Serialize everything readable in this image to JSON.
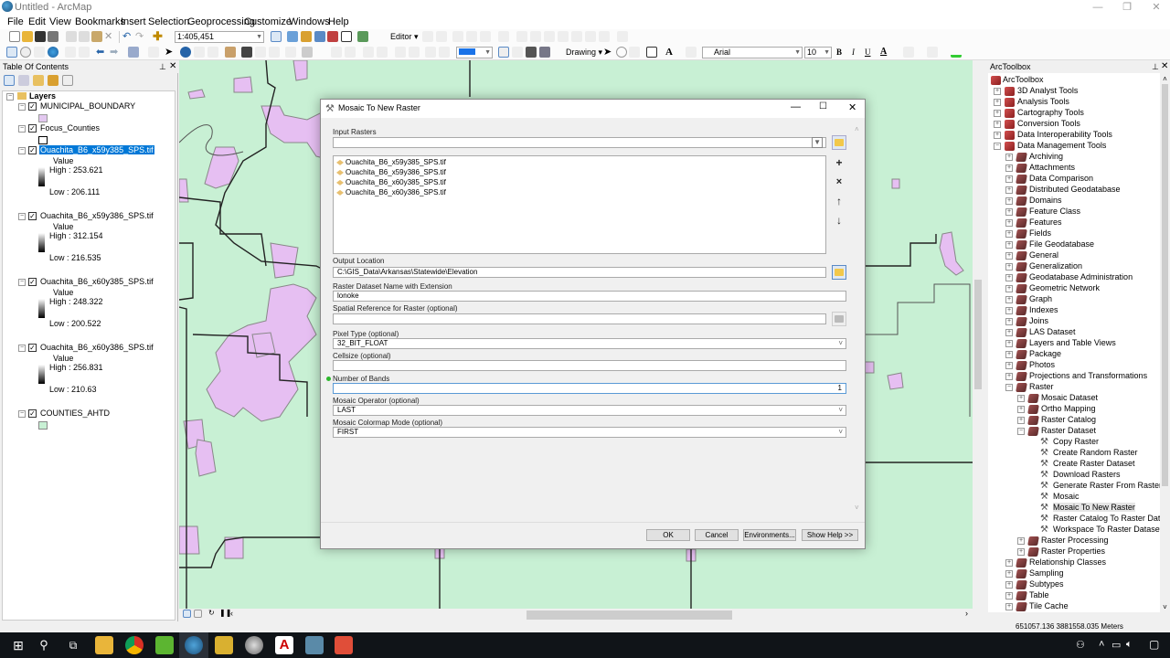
{
  "window": {
    "title": "Untitled - ArcMap",
    "controls": {
      "minimize": "—",
      "restore": "❐",
      "close": "✕"
    }
  },
  "menu": [
    "File",
    "Edit",
    "View",
    "Bookmarks",
    "Insert",
    "Selection",
    "Geoprocessing",
    "Customize",
    "Windows",
    "Help"
  ],
  "toolbar": {
    "scale_value": "1:405,451",
    "editor_label": "Editor ▾",
    "drawing_label": "Drawing ▾",
    "font_name": "Arial",
    "font_size": "10",
    "bold": "B",
    "italic": "I",
    "underline": "U",
    "font_color": "A"
  },
  "toc": {
    "title": "Table Of Contents",
    "root": "Layers",
    "layers": [
      {
        "name": "MUNICIPAL_BOUNDARY",
        "checked": true,
        "swatch": "#e3c8f0"
      },
      {
        "name": "Focus_Counties",
        "checked": true,
        "swatch": "#ffffff"
      },
      {
        "name": "Ouachita_B6_x59y385_SPS.tif",
        "checked": true,
        "selected": true,
        "legend_title": "Value",
        "high": "High : 253.621",
        "low": "Low : 206.111"
      },
      {
        "name": "Ouachita_B6_x59y386_SPS.tif",
        "checked": true,
        "legend_title": "Value",
        "high": "High : 312.154",
        "low": "Low : 216.535"
      },
      {
        "name": "Ouachita_B6_x60y385_SPS.tif",
        "checked": true,
        "legend_title": "Value",
        "high": "High : 248.322",
        "low": "Low : 200.522"
      },
      {
        "name": "Ouachita_B6_x60y386_SPS.tif",
        "checked": true,
        "legend_title": "Value",
        "high": "High : 256.831",
        "low": "Low : 210.63"
      },
      {
        "name": "COUNTIES_AHTD",
        "checked": true,
        "swatch": "#c8f0d4"
      }
    ]
  },
  "dialog": {
    "title": "Mosaic To New Raster",
    "input_rasters_label": "Input Rasters",
    "input_rasters_value": "",
    "input_rasters_list": [
      "Ouachita_B6_x59y385_SPS.tif",
      "Ouachita_B6_x59y386_SPS.tif",
      "Ouachita_B6_x60y385_SPS.tif",
      "Ouachita_B6_x60y386_SPS.tif"
    ],
    "output_location_label": "Output Location",
    "output_location_value": "C:\\GIS_Data\\Arkansas\\Statewide\\Elevation",
    "dataset_name_label": "Raster Dataset Name with Extension",
    "dataset_name_value": "lonoke",
    "spatial_ref_label": "Spatial Reference for Raster (optional)",
    "spatial_ref_value": "",
    "pixel_type_label": "Pixel Type (optional)",
    "pixel_type_value": "32_BIT_FLOAT",
    "cellsize_label": "Cellsize (optional)",
    "cellsize_value": "",
    "bands_label": "Number of Bands",
    "bands_value": "1",
    "mosaic_operator_label": "Mosaic Operator (optional)",
    "mosaic_operator_value": "LAST",
    "colormap_mode_label": "Mosaic Colormap Mode (optional)",
    "colormap_mode_value": "FIRST",
    "buttons": {
      "ok": "OK",
      "cancel": "Cancel",
      "environments": "Environments...",
      "show_help": "Show Help >>"
    },
    "side_buttons": {
      "add": "+",
      "remove": "×",
      "up": "↑",
      "down": "↓"
    }
  },
  "arctoolbox": {
    "title": "ArcToolbox",
    "root": "ArcToolbox",
    "items": [
      {
        "label": "3D Analyst Tools",
        "level": 0,
        "type": "toolbox",
        "expander": "+"
      },
      {
        "label": "Analysis Tools",
        "level": 0,
        "type": "toolbox",
        "expander": "+"
      },
      {
        "label": "Cartography Tools",
        "level": 0,
        "type": "toolbox",
        "expander": "+"
      },
      {
        "label": "Conversion Tools",
        "level": 0,
        "type": "toolbox",
        "expander": "+"
      },
      {
        "label": "Data Interoperability Tools",
        "level": 0,
        "type": "toolbox",
        "expander": "+"
      },
      {
        "label": "Data Management Tools",
        "level": 0,
        "type": "toolbox",
        "expander": "−"
      },
      {
        "label": "Archiving",
        "level": 1,
        "type": "toolset",
        "expander": "+"
      },
      {
        "label": "Attachments",
        "level": 1,
        "type": "toolset",
        "expander": "+"
      },
      {
        "label": "Data Comparison",
        "level": 1,
        "type": "toolset",
        "expander": "+"
      },
      {
        "label": "Distributed Geodatabase",
        "level": 1,
        "type": "toolset",
        "expander": "+"
      },
      {
        "label": "Domains",
        "level": 1,
        "type": "toolset",
        "expander": "+"
      },
      {
        "label": "Feature Class",
        "level": 1,
        "type": "toolset",
        "expander": "+"
      },
      {
        "label": "Features",
        "level": 1,
        "type": "toolset",
        "expander": "+"
      },
      {
        "label": "Fields",
        "level": 1,
        "type": "toolset",
        "expander": "+"
      },
      {
        "label": "File Geodatabase",
        "level": 1,
        "type": "toolset",
        "expander": "+"
      },
      {
        "label": "General",
        "level": 1,
        "type": "toolset",
        "expander": "+"
      },
      {
        "label": "Generalization",
        "level": 1,
        "type": "toolset",
        "expander": "+"
      },
      {
        "label": "Geodatabase Administration",
        "level": 1,
        "type": "toolset",
        "expander": "+"
      },
      {
        "label": "Geometric Network",
        "level": 1,
        "type": "toolset",
        "expander": "+"
      },
      {
        "label": "Graph",
        "level": 1,
        "type": "toolset",
        "expander": "+"
      },
      {
        "label": "Indexes",
        "level": 1,
        "type": "toolset",
        "expander": "+"
      },
      {
        "label": "Joins",
        "level": 1,
        "type": "toolset",
        "expander": "+"
      },
      {
        "label": "LAS Dataset",
        "level": 1,
        "type": "toolset",
        "expander": "+"
      },
      {
        "label": "Layers and Table Views",
        "level": 1,
        "type": "toolset",
        "expander": "+"
      },
      {
        "label": "Package",
        "level": 1,
        "type": "toolset",
        "expander": "+"
      },
      {
        "label": "Photos",
        "level": 1,
        "type": "toolset",
        "expander": "+"
      },
      {
        "label": "Projections and Transformations",
        "level": 1,
        "type": "toolset",
        "expander": "+"
      },
      {
        "label": "Raster",
        "level": 1,
        "type": "toolset",
        "expander": "−"
      },
      {
        "label": "Mosaic Dataset",
        "level": 2,
        "type": "toolset",
        "expander": "+"
      },
      {
        "label": "Ortho Mapping",
        "level": 2,
        "type": "toolset",
        "expander": "+"
      },
      {
        "label": "Raster Catalog",
        "level": 2,
        "type": "toolset",
        "expander": "+"
      },
      {
        "label": "Raster Dataset",
        "level": 2,
        "type": "toolset",
        "expander": "−"
      },
      {
        "label": "Copy Raster",
        "level": 3,
        "type": "tool"
      },
      {
        "label": "Create Random Raster",
        "level": 3,
        "type": "tool"
      },
      {
        "label": "Create Raster Dataset",
        "level": 3,
        "type": "tool"
      },
      {
        "label": "Download Rasters",
        "level": 3,
        "type": "tool"
      },
      {
        "label": "Generate Raster From Raster Funct",
        "level": 3,
        "type": "tool"
      },
      {
        "label": "Mosaic",
        "level": 3,
        "type": "tool"
      },
      {
        "label": "Mosaic To New Raster",
        "level": 3,
        "type": "tool",
        "highlighted": true
      },
      {
        "label": "Raster Catalog To Raster Dataset",
        "level": 3,
        "type": "tool"
      },
      {
        "label": "Workspace To Raster Dataset",
        "level": 3,
        "type": "tool"
      },
      {
        "label": "Raster Processing",
        "level": 2,
        "type": "toolset",
        "expander": "+"
      },
      {
        "label": "Raster Properties",
        "level": 2,
        "type": "toolset",
        "expander": "+"
      },
      {
        "label": "Relationship Classes",
        "level": 1,
        "type": "toolset",
        "expander": "+"
      },
      {
        "label": "Sampling",
        "level": 1,
        "type": "toolset",
        "expander": "+"
      },
      {
        "label": "Subtypes",
        "level": 1,
        "type": "toolset",
        "expander": "+"
      },
      {
        "label": "Table",
        "level": 1,
        "type": "toolset",
        "expander": "+"
      },
      {
        "label": "Tile Cache",
        "level": 1,
        "type": "toolset",
        "expander": "+"
      }
    ]
  },
  "status": {
    "coordinates": "651057.136  3881558.035 Meters"
  },
  "colors": {
    "map_bg": "#c8f0d4",
    "municipal": "#e6bff2",
    "selection": "#0078d7",
    "taskbar": "#101418"
  },
  "taskbar": {
    "apps": [
      "windows-start",
      "search",
      "task-view",
      "file-explorer",
      "chrome",
      "camtasia",
      "arcmap",
      "arccatalog",
      "globe",
      "autocad",
      "network-tool",
      "camtasia-recorder"
    ]
  }
}
